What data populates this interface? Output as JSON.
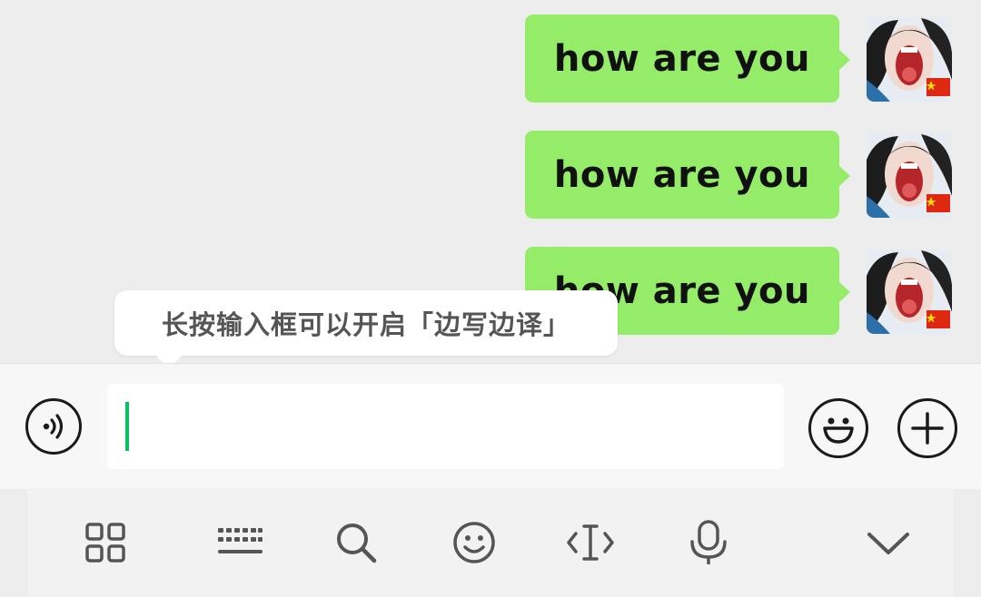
{
  "messages": [
    {
      "text": "how are you",
      "sender": "self"
    },
    {
      "text": "how are you",
      "sender": "self"
    },
    {
      "text": "how are you",
      "sender": "self"
    }
  ],
  "tooltip": {
    "text": "长按输入框可以开启「边写边译」"
  },
  "input": {
    "value": "",
    "placeholder": ""
  },
  "icons": {
    "voice": "voice-icon",
    "emoji": "emoji-icon",
    "plus": "plus-icon",
    "toolbar": [
      "grid-icon",
      "keyboard-icon",
      "search-icon",
      "smiley-icon",
      "text-cursor-icon",
      "microphone-icon",
      "chevron-down-icon"
    ]
  },
  "colors": {
    "bubble": "#95ec69",
    "caret": "#07c160",
    "background": "#ededed"
  }
}
